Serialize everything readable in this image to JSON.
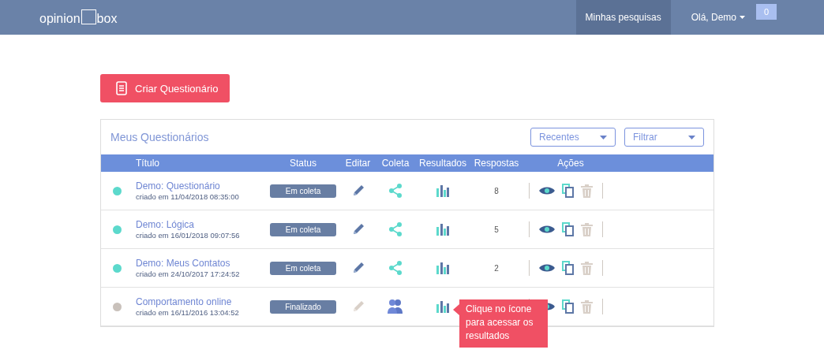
{
  "navbar": {
    "logo_left": "opinion",
    "logo_right": "box",
    "menu": [
      {
        "label": "Minhas pesquisas",
        "selected": true
      }
    ],
    "user": "Olá, Demo",
    "notifications": "0"
  },
  "create_button": "Criar Questionário",
  "panel": {
    "title": "Meus Questionários",
    "dropdowns": [
      "Recentes",
      "Filtrar"
    ],
    "columns": [
      "Título",
      "Status",
      "Editar",
      "Coleta",
      "Resultados",
      "Respostas",
      "Ações"
    ],
    "rows": [
      {
        "title": "Demo: Questionário",
        "created": "criado em 11/04/2018 08:35:00",
        "color": "#5cd9cc",
        "status": "Em coleta",
        "editable": true,
        "coleta": {
          "kind": "share"
        },
        "responses": "8"
      },
      {
        "title": "Demo: Lógica",
        "created": "criado em 16/01/2018 09:07:56",
        "color": "#5cd9cc",
        "status": "Em coleta",
        "editable": true,
        "coleta": {
          "kind": "share"
        },
        "responses": "5"
      },
      {
        "title": "Demo: Meus Contatos",
        "created": "criado em 24/10/2017 17:24:52",
        "color": "#5cd9cc",
        "status": "Em coleta",
        "editable": true,
        "coleta": {
          "kind": "share"
        },
        "responses": "2"
      },
      {
        "title": "Comportamento online",
        "created": "criado em 16/11/2016 13:04:52",
        "color": "#c9c1bb",
        "status": "Finalizado",
        "editable": false,
        "coleta": {
          "kind": "panel"
        }
      }
    ]
  },
  "tooltip": "Clique no ícone para acessar os resultados"
}
